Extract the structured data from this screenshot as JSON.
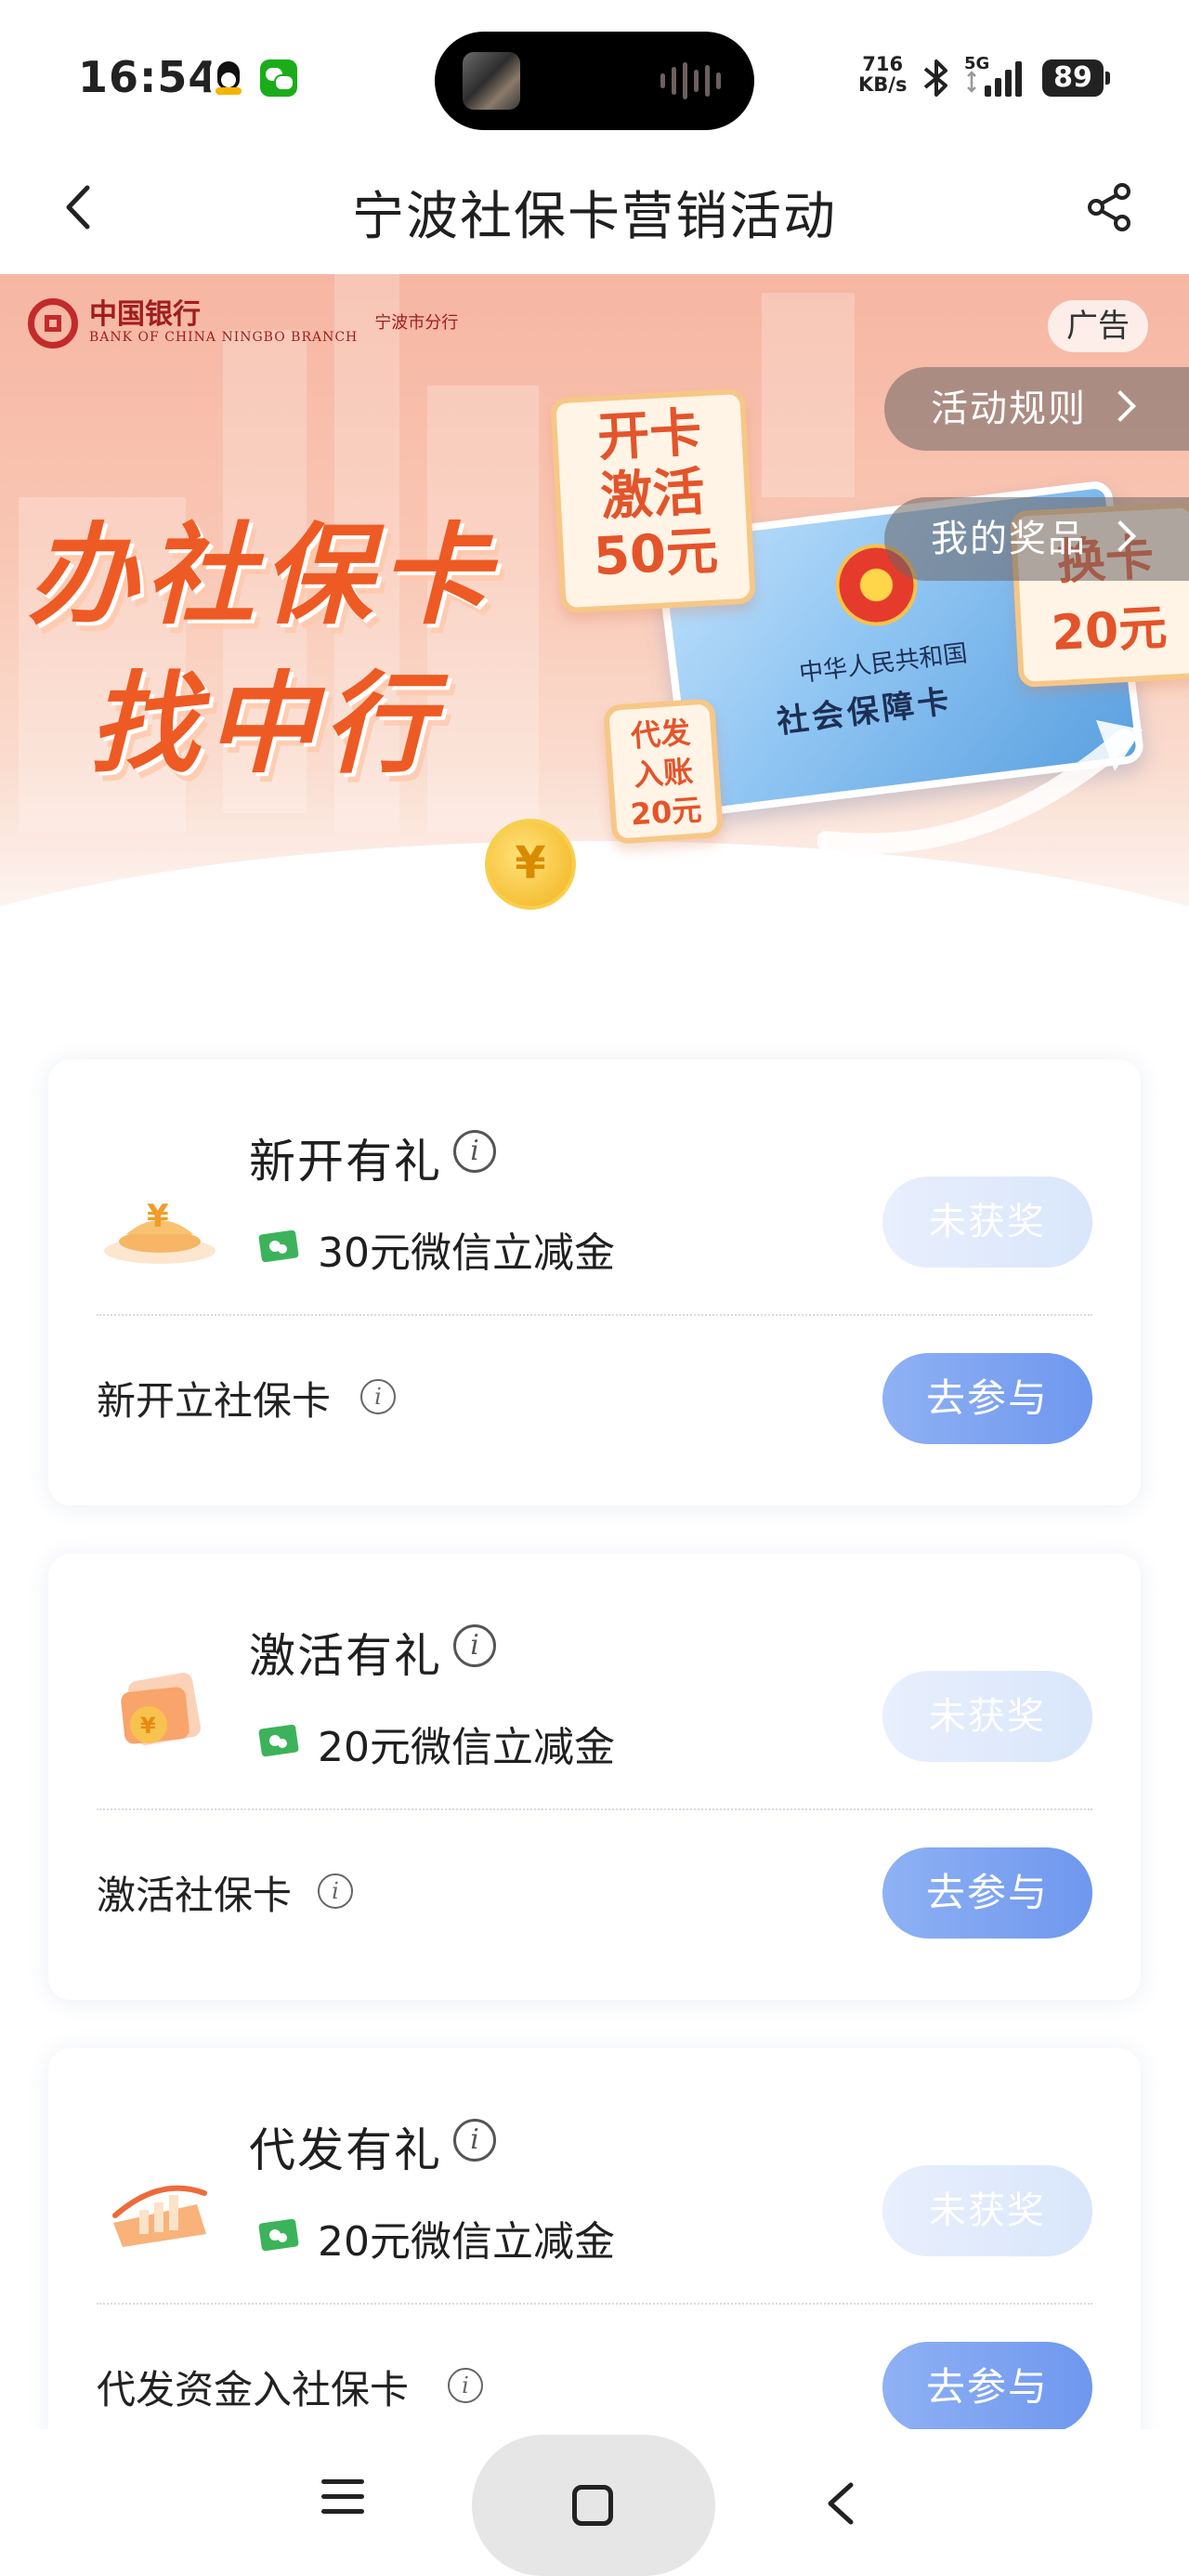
{
  "status_bar": {
    "time": "16:54",
    "net_speed_value": "716",
    "net_speed_unit": "KB/s",
    "network_type": "5G",
    "battery": "89",
    "icons": [
      "qq-icon",
      "wechat-icon",
      "bluetooth-icon",
      "signal-icon",
      "battery-icon"
    ]
  },
  "nav": {
    "title": "宁波社保卡营销活动",
    "back_icon": "back-icon",
    "share_icon": "share-icon"
  },
  "banner": {
    "bank_name": "中国银行",
    "bank_name_en": "BANK OF CHINA  NINGBO BRANCH",
    "branch": "宁波市分行",
    "ad_label": "广告",
    "slogan_line1": "办社保卡",
    "slogan_line2": "找中行",
    "stamp_open": [
      "开卡",
      "激活",
      "50元"
    ],
    "stamp_payroll": [
      "代发",
      "入账",
      "20元"
    ],
    "stamp_replace": [
      "换卡",
      "20元"
    ],
    "card_text1": "中华人民共和国",
    "card_text2": "社会保障卡",
    "rules_label": "活动规则",
    "prizes_label": "我的奖品"
  },
  "cards": [
    {
      "title": "新开有礼",
      "reward": "30元微信立减金",
      "status": "未获奖",
      "task": "新开立社保卡",
      "action": "去参与"
    },
    {
      "title": "激活有礼",
      "reward": "20元微信立减金",
      "status": "未获奖",
      "task": "激活社保卡",
      "action": "去参与"
    },
    {
      "title": "代发有礼",
      "reward": "20元微信立减金",
      "status": "未获奖",
      "task": "代发资金入社保卡",
      "action": "去参与"
    }
  ],
  "colors": {
    "accent_blue": "#7a9ff0",
    "disabled_blue": "#dde8fb",
    "slogan_orange": "#ee5a24",
    "banner_pink": "#f6b6a2"
  },
  "bottom_nav": {
    "icons": [
      "menu-icon",
      "home-icon",
      "back-icon"
    ]
  }
}
